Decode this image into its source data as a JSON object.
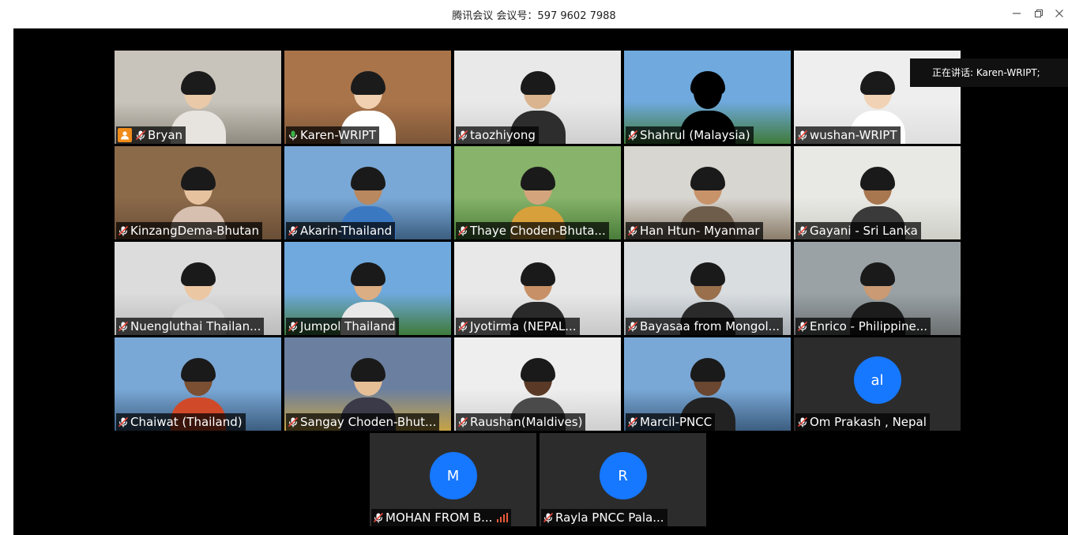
{
  "window": {
    "title": "腾讯会议 会议号：597 9602 7988",
    "controls": [
      "minimize",
      "restore",
      "close"
    ]
  },
  "speaking": "正在讲话: Karen-WRIPT;",
  "tiles": [
    {
      "name": "Bryan",
      "host": true
    },
    {
      "name": "Karen-WRIPT",
      "active": true
    },
    {
      "name": "taozhiyong"
    },
    {
      "name": "Shahrul (Malaysia)"
    },
    {
      "name": "wushan-WRIPT"
    },
    {
      "name": "KinzangDema-Bhutan"
    },
    {
      "name": "Akarin-Thailand"
    },
    {
      "name": "Thaye Choden-Bhuta..."
    },
    {
      "name": "Han Htun- Myanmar"
    },
    {
      "name": "Gayani - Sri Lanka"
    },
    {
      "name": "Nuengluthai Thailan..."
    },
    {
      "name": "Jumpol Thailand"
    },
    {
      "name": "Jyotirma (NEPAL..."
    },
    {
      "name": "Bayasaa from Mongol..."
    },
    {
      "name": "Enrico - Philippine..."
    },
    {
      "name": "Chaiwat  (Thailand)"
    },
    {
      "name": "Sangay Choden-Bhut..."
    },
    {
      "name": "Raushan(Maldives)"
    },
    {
      "name": "Marcil-PNCC"
    },
    {
      "name": "Om Prakash , Nepal",
      "avatar": "al"
    },
    {
      "name": "MOHAN FROM B...",
      "avatar": "M",
      "signal": true
    },
    {
      "name": "Rayla PNCC Pala...",
      "avatar": "R"
    }
  ],
  "colors": {
    "avatar": "#1677ff",
    "active_outline": "#3cb34a",
    "host_badge": "#f08c1a"
  }
}
